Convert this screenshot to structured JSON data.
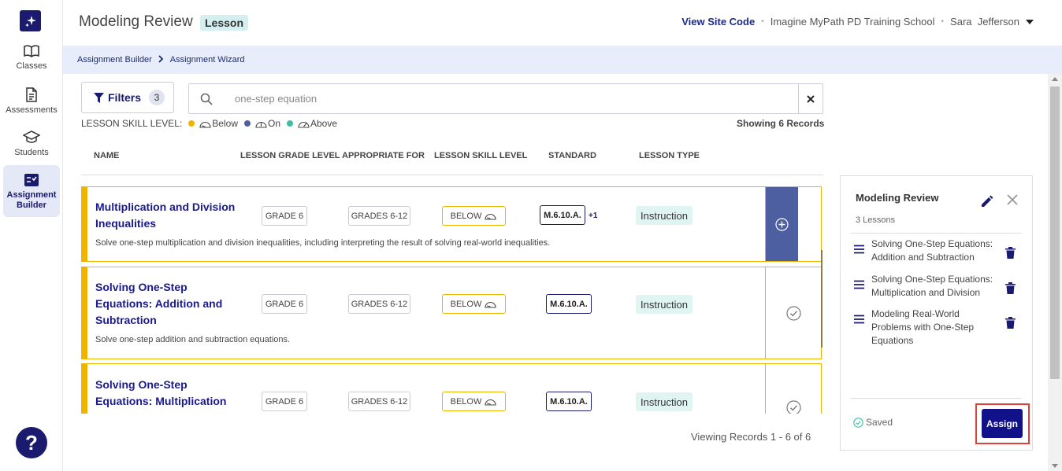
{
  "nav": {
    "items": [
      {
        "label": "Classes",
        "icon": "book-open-icon"
      },
      {
        "label": "Assessments",
        "icon": "document-icon"
      },
      {
        "label": "Students",
        "icon": "graduation-cap-icon"
      },
      {
        "label": "Assignment Builder",
        "icon": "checklist-icon",
        "active": true
      }
    ],
    "help": "?"
  },
  "header": {
    "title": "Modeling Review",
    "badge": "Lesson",
    "site_code_link": "View Site Code",
    "school": "Imagine MyPath PD Training School",
    "user_first": "Sara",
    "user_last": "Jefferson"
  },
  "breadcrumb": [
    "Assignment Builder",
    "Assignment Wizard"
  ],
  "filters": {
    "label": "Filters",
    "count": "3"
  },
  "search": {
    "query": "one-step equation"
  },
  "legend": {
    "label": "LESSON SKILL LEVEL:",
    "below": "Below",
    "on": "On",
    "above": "Above",
    "colors": {
      "below": "#f0b400",
      "on": "#4d5fa0",
      "above": "#3dbfa5"
    }
  },
  "showing": "Showing 6 Records",
  "columns": [
    "NAME",
    "LESSON GRADE LEVEL",
    "APPROPRIATE FOR",
    "LESSON SKILL LEVEL",
    "STANDARD",
    "LESSON TYPE"
  ],
  "lessons": [
    {
      "name_lines": [
        "Multiplication and Division",
        "Inequalities"
      ],
      "description": "Solve one-step multiplication and division inequalities, including interpreting the result of solving real-world inequalities.",
      "grade": "GRADE 6",
      "appropriate": "GRADES 6-12",
      "skill": "BELOW",
      "standard": "M.6.10.A.",
      "standard_more": "+1",
      "type": "Instruction"
    },
    {
      "name_lines": [
        "Solving One-Step",
        "Equations: Addition and",
        "Subtraction"
      ],
      "description": "Solve one-step addition and subtraction equations.",
      "grade": "GRADE 6",
      "appropriate": "GRADES 6-12",
      "skill": "BELOW",
      "standard": "M.6.10.A.",
      "type": "Instruction"
    },
    {
      "name_lines": [
        "Solving One-Step",
        "Equations: Multiplication"
      ],
      "grade": "GRADE 6",
      "appropriate": "GRADES 6-12",
      "skill": "BELOW",
      "standard": "M.6.10.A.",
      "type": "Instruction"
    }
  ],
  "viewing": "Viewing Records 1 - 6 of 6",
  "panel": {
    "title": "Modeling Review",
    "subtitle": "3 Lessons",
    "items": [
      "Solving One-Step Equations: Addition and Subtraction",
      "Solving One-Step Equations: Multiplication and Division",
      "Modeling Real-World Problems with One-Step Equations"
    ],
    "saved": "Saved",
    "assign": "Assign"
  }
}
